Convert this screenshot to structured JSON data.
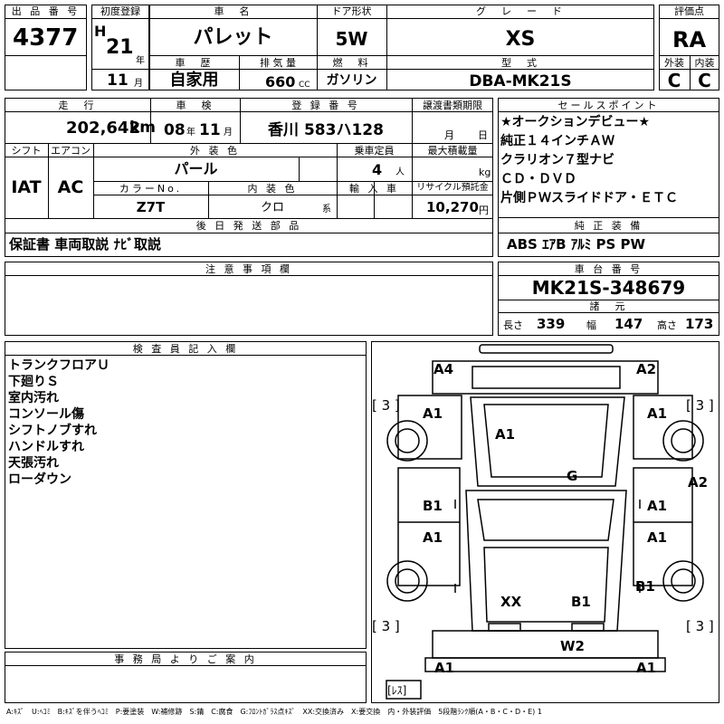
{
  "header_labels": {
    "lot_no": "出 品 番 号",
    "first_reg": "初度登録",
    "car_name": "車　名",
    "door": "ドア形状",
    "grade": "グ　レ　ー　ド",
    "score": "評価点",
    "history": "車　歴",
    "displacement": "排 気 量",
    "fuel": "燃　料",
    "model": "型　式",
    "exterior": "外装",
    "interior": "内装"
  },
  "lot_no": "4377",
  "era": "H",
  "year": "21",
  "year_unit": "年",
  "month": "11",
  "month_unit": "月",
  "car_name": "パレット",
  "door": "5W",
  "grade": "XS",
  "score": "RA",
  "history": "自家用",
  "displacement": "660",
  "displacement_unit": "CC",
  "fuel": "ガソリン",
  "model": "DBA-MK21S",
  "exterior": "C",
  "interior": "C",
  "row2_labels": {
    "mileage": "走　行",
    "inspection": "車　検",
    "plate": "登 録 番 号",
    "docs": "譲渡書類期限",
    "sales_point": "セールスポイント",
    "shift": "シフト",
    "ac": "エアコン",
    "color": "外 装 色",
    "capacity": "乗車定員",
    "load": "最大積載量",
    "color_no": "カラーNo.",
    "int_color": "内 装 色",
    "import": "輸 入 車",
    "recycle": "リサイクル預託金",
    "later_parts": "後 日 発 送 部 品",
    "equipment": "純 正 装 備",
    "caution": "注 意 事 項 欄",
    "chassis": "車 台 番 号",
    "spec": "諸　元",
    "inspector": "検 査 員 記 入 欄",
    "office": "事 務 局 よ り ご 案 内"
  },
  "mileage": "202,642",
  "mileage_unit": "km",
  "insp_year": "08",
  "insp_year_unit": "年",
  "insp_month": "11",
  "insp_month_unit": "月",
  "plate": "香川 583ハ128",
  "docs_month": "月",
  "docs_day": "日",
  "shift": "IAT",
  "ac": "AC",
  "color": "パール",
  "capacity": "4",
  "capacity_unit": "人",
  "load_unit": "kg",
  "color_no": "Z7T",
  "int_color": "クロ",
  "int_color_suffix": "系",
  "recycle": "10,270",
  "recycle_unit": "円",
  "later_parts": "保証書 車両取説 ﾅﾋﾞ取説",
  "sales_points": [
    "★オークションデビュー★",
    "純正１４インチＡＷ",
    "クラリオン７型ナビ",
    "ＣＤ・ＤＶＤ",
    "片側ＰＷスライドドア・ＥＴＣ"
  ],
  "equipment": "ABS ｴｱB ｱﾙﾐ PS PW",
  "chassis_no": "MK21S-348679",
  "spec": {
    "length_label": "長さ",
    "length": "339",
    "width_label": "幅",
    "width": "147",
    "height_label": "高さ",
    "height": "173"
  },
  "inspector_notes": [
    "トランクフロアＵ",
    "下廻りＳ",
    "室内汚れ",
    "コンソール傷",
    "シフトノブすれ",
    "ハンドルすれ",
    "天張汚れ",
    "ローダウン"
  ],
  "diagram_marks": {
    "a4": "A4",
    "a2_top": "A2",
    "a1_fl": "A1",
    "a1_hood": "A1",
    "a1_fr": "A1",
    "a2_right": "A2",
    "g": "G",
    "b1_left": "B1",
    "a1_mid_r": "A1",
    "a1_rl": "A1",
    "a1_rr": "A1",
    "xx": "XX",
    "b1_roof": "B1",
    "b1_rear_r": "B1",
    "w2": "W2",
    "a1_bl": "A1",
    "a1_br": "A1",
    "bracket3": "[ 3 ]",
    "spare": "[ﾚｽ]"
  },
  "legend": "A:ｷｽﾞ　U:ﾍｺﾐ　B:ｷｽﾞを伴うﾍｺﾐ　P:要塗装　W:補修跡　S:錆　C:腐食　G:ﾌﾛﾝﾄｶﾞﾗｽ点ｷｽﾞ　XX:交換済み　X:要交換　内・外装評価　5段階ﾗﾝｸ順(A・B・C・D・E) 1"
}
